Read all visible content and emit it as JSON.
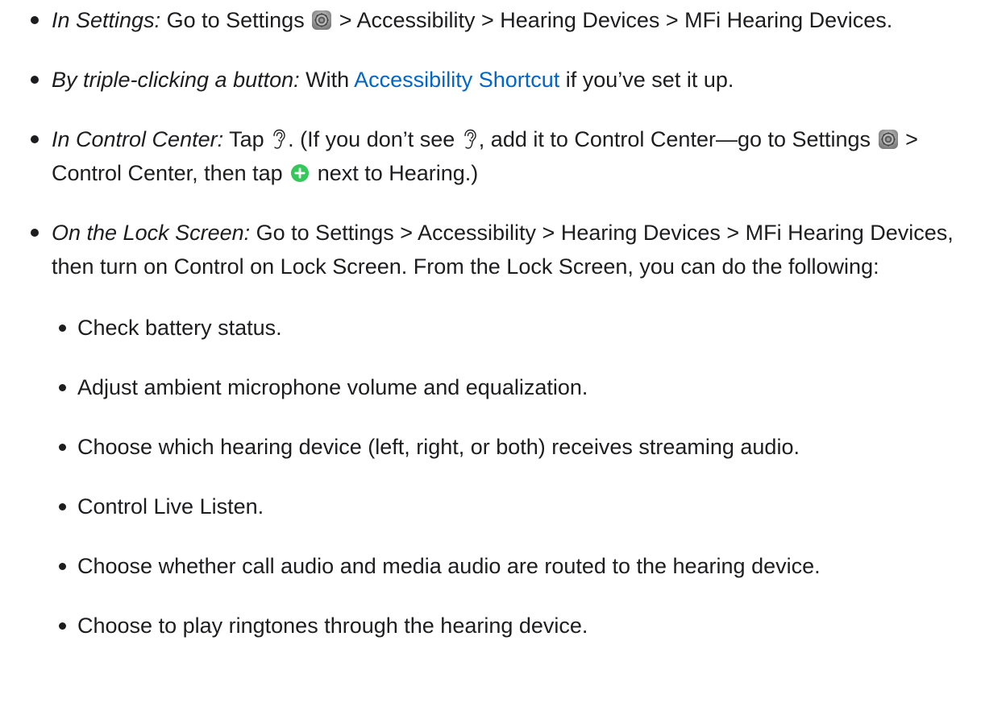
{
  "items": [
    {
      "label": "In Settings:",
      "text_a": " Go to Settings ",
      "text_b": " > Accessibility > Hearing Devices > MFi Hearing Devices."
    },
    {
      "label": "By triple-clicking a button:",
      "text_a": " With ",
      "link": "Accessibility Shortcut",
      "text_b": " if you’ve set it up."
    },
    {
      "label": "In Control Center:",
      "text_a": " Tap ",
      "text_b": ". (If you don’t see ",
      "text_c": ", add it to Control Center—go to Settings ",
      "text_d": " > Control Center, then tap ",
      "text_e": " next to Hearing.)"
    },
    {
      "label": "On the Lock Screen:",
      "text_a": " Go to Settings > Accessibility > Hearing Devices > MFi Hearing Devices, then turn on Control on Lock Screen. From the Lock Screen, you can do the following:",
      "sub_items": [
        "Check battery status.",
        "Adjust ambient microphone volume and equalization.",
        "Choose which hearing device (left, right, or both) receives streaming audio.",
        "Control Live Listen.",
        "Choose whether call audio and media audio are routed to the hearing device.",
        "Choose to play ringtones through the hearing device."
      ]
    }
  ],
  "icons": {
    "settings": "settings-gear-icon",
    "hearing": "hearing-ear-icon",
    "add": "add-plus-icon"
  },
  "colors": {
    "text": "#1d1d1f",
    "link": "#0066cc",
    "add_icon": "#34c759"
  }
}
